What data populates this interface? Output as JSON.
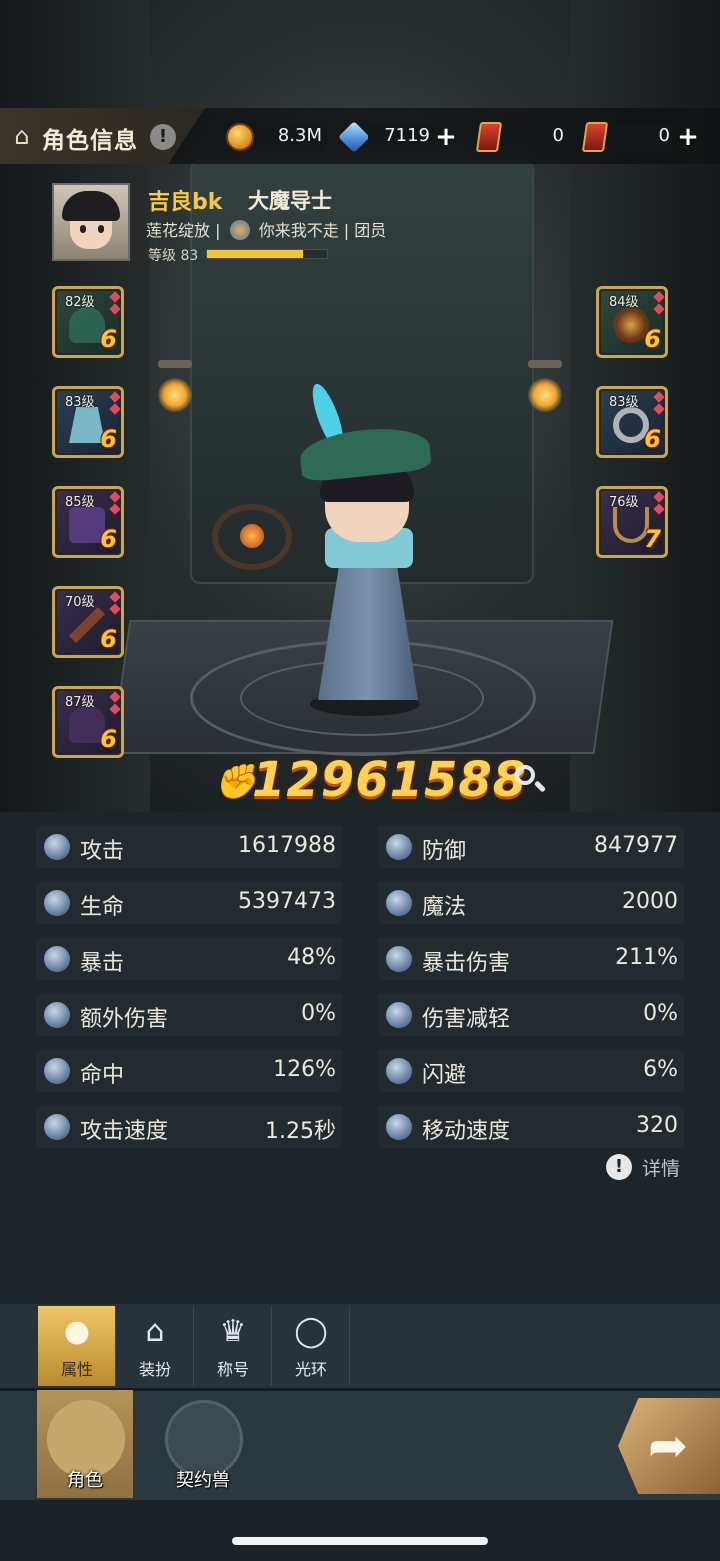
{
  "header": {
    "title": "角色信息",
    "info_icon": "exclamation-icon",
    "resources": [
      {
        "icon": "gold-coin-icon",
        "value": "8.3M"
      },
      {
        "icon": "crystal-icon",
        "value": "7119",
        "add": "+"
      },
      {
        "icon": "red-card-icon",
        "value": "0"
      },
      {
        "icon": "scroll-card-icon",
        "value": "0",
        "add": "+"
      }
    ]
  },
  "profile": {
    "name": "吉良bk",
    "class": "大魔导士",
    "title": "莲花绽放",
    "guild_name": "你来我不走",
    "guild_role": "团员",
    "level_label": "等级 83",
    "level_progress": 0.8
  },
  "equipment": {
    "left": [
      {
        "level": "82级",
        "stars": "6",
        "item": "hat"
      },
      {
        "level": "83级",
        "stars": "6",
        "item": "robe"
      },
      {
        "level": "85级",
        "stars": "6",
        "item": "boots"
      },
      {
        "level": "70级",
        "stars": "6",
        "item": "weapon"
      },
      {
        "level": "87级",
        "stars": "6",
        "item": "cloak"
      }
    ],
    "right": [
      {
        "level": "84级",
        "stars": "6",
        "item": "orb"
      },
      {
        "level": "83级",
        "stars": "6",
        "item": "ring"
      },
      {
        "level": "76级",
        "stars": "7",
        "item": "necklace"
      }
    ]
  },
  "power": {
    "value": "12961588",
    "icon": "power-fist-icon",
    "search_icon": "search-icon"
  },
  "stats": {
    "left": [
      {
        "label": "攻击",
        "value": "1617988",
        "icon": "sword-icon"
      },
      {
        "label": "生命",
        "value": "5397473",
        "icon": "heart-icon"
      },
      {
        "label": "暴击",
        "value": "48%",
        "icon": "critical-icon"
      },
      {
        "label": "额外伤害",
        "value": "0%",
        "icon": "extra-damage-icon"
      },
      {
        "label": "命中",
        "value": "126%",
        "icon": "target-icon"
      },
      {
        "label": "攻击速度",
        "value": "1.25秒",
        "icon": "attack-speed-icon"
      }
    ],
    "right": [
      {
        "label": "防御",
        "value": "847977",
        "icon": "shield-icon"
      },
      {
        "label": "魔法",
        "value": "2000",
        "icon": "magic-icon"
      },
      {
        "label": "暴击伤害",
        "value": "211%",
        "icon": "critical-damage-icon"
      },
      {
        "label": "伤害减轻",
        "value": "0%",
        "icon": "damage-reduction-icon"
      },
      {
        "label": "闪避",
        "value": "6%",
        "icon": "dodge-icon"
      },
      {
        "label": "移动速度",
        "value": "320",
        "icon": "move-speed-icon"
      }
    ],
    "detail_label": "详情"
  },
  "subtabs": [
    {
      "label": "属性",
      "icon": "person-icon",
      "active": true
    },
    {
      "label": "装扮",
      "icon": "hanger-icon",
      "active": false
    },
    {
      "label": "称号",
      "icon": "crown-icon",
      "active": false
    },
    {
      "label": "光环",
      "icon": "halo-icon",
      "active": false
    }
  ],
  "bottom_nav": [
    {
      "label": "角色",
      "icon": "character-icon",
      "active": true
    },
    {
      "label": "契约兽",
      "icon": "paw-icon",
      "active": false
    }
  ],
  "share": {
    "icon": "share-arrow-icon"
  }
}
